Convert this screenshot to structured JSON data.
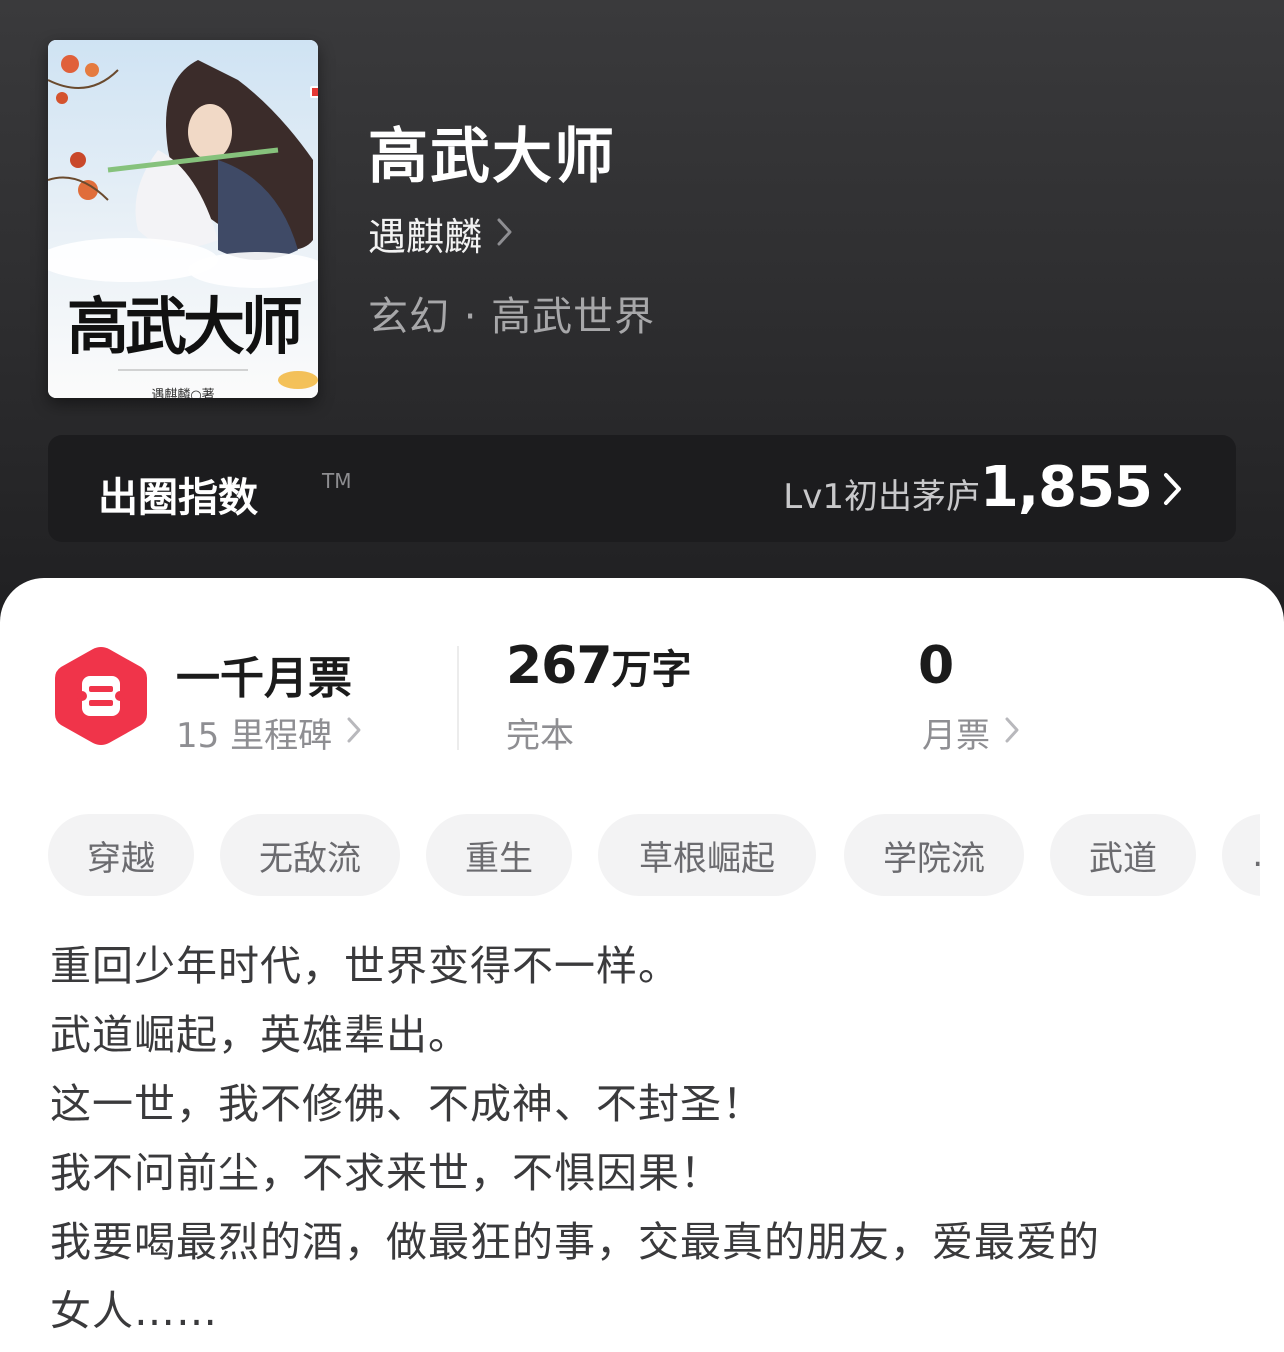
{
  "book": {
    "cover_title": "高武大师",
    "cover_author": "遇麒麟○著",
    "title": "高武大师",
    "author": "遇麒麟",
    "genre": "玄幻 · 高武世界"
  },
  "index": {
    "label": "出圈指数",
    "tm": "TM",
    "level": "Lv1初出茅庐",
    "value": "1,855"
  },
  "stats": {
    "ticket_title": "一千月票",
    "milestones": "15 里程碑",
    "words_num": "267",
    "words_unit": "万字",
    "status": "完本",
    "monthly_value": "0",
    "monthly_label": "月票"
  },
  "tags": [
    "穿越",
    "无敌流",
    "重生",
    "草根崛起",
    "学院流",
    "武道",
    "…"
  ],
  "description": [
    "重回少年时代，世界变得不一样。",
    "武道崛起，英雄辈出。",
    "这一世，我不修佛、不成神、不封圣！",
    "我不问前尘，不求来世，不惧因果！",
    "我要喝最烈的酒，做最狂的事，交最真的朋友，爱最爱的",
    "女人……"
  ],
  "colors": {
    "header_bg": "#2e2e30",
    "index_bar_bg": "#1c1c1e",
    "ticket_red": "#f0344a",
    "tag_bg": "#f3f3f4"
  }
}
